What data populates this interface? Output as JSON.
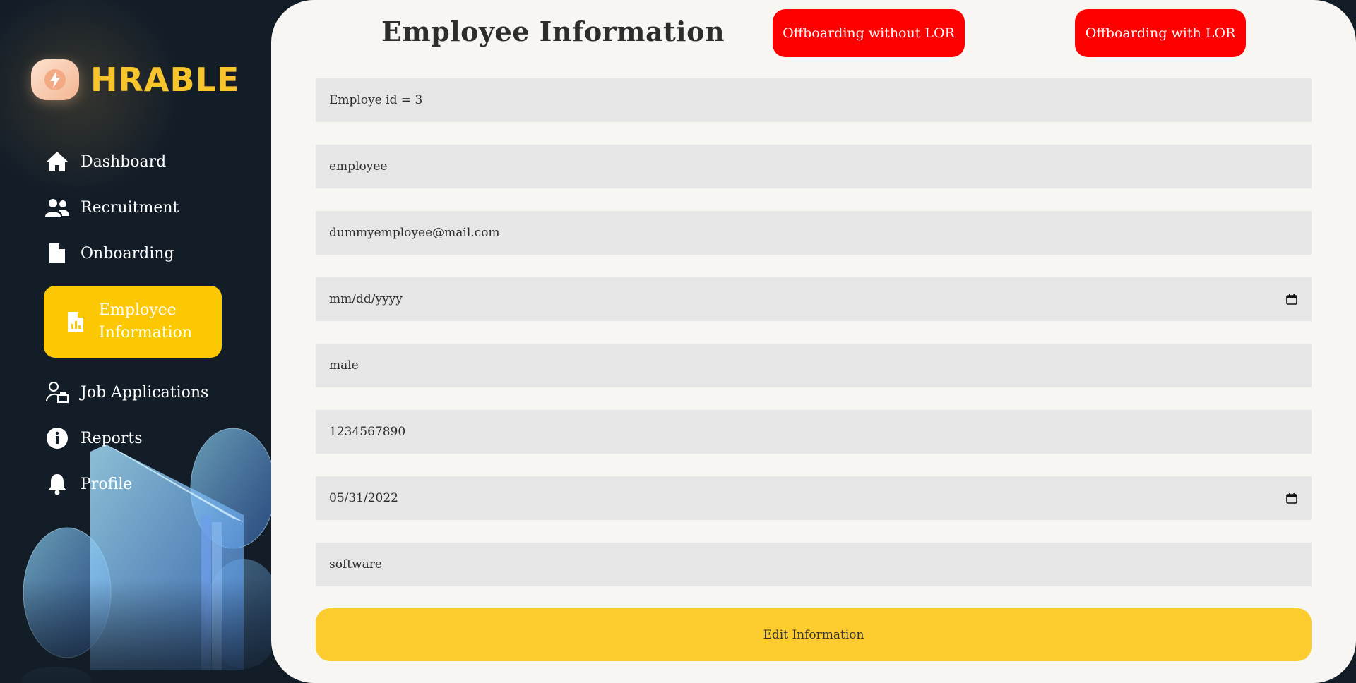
{
  "brand": {
    "name": "HRABLE",
    "logo_icon": "bolt-icon"
  },
  "sidebar": {
    "items": [
      {
        "label": "Dashboard",
        "icon": "home-icon"
      },
      {
        "label": "Recruitment",
        "icon": "users-icon"
      },
      {
        "label": "Onboarding",
        "icon": "file-icon"
      },
      {
        "label": "Employee Information",
        "icon": "file-chart-icon",
        "active": true
      },
      {
        "label": "Job Applications",
        "icon": "user-briefcase-icon"
      },
      {
        "label": "Reports",
        "icon": "info-icon"
      },
      {
        "label": "Profile",
        "icon": "bell-icon"
      }
    ]
  },
  "header": {
    "title": "Employee Information",
    "offboarding_without_lor": "Offboarding without LOR",
    "offboarding_with_lor": "Offboarding with LOR"
  },
  "form": {
    "employee_id": "Employe id = 3",
    "name": "employee",
    "email": "dummyemployee@mail.com",
    "dob_placeholder": "mm/dd/yyyy",
    "gender": "male",
    "phone": "1234567890",
    "join_date": "05/31/2022",
    "department": "software"
  },
  "actions": {
    "edit_label": "Edit Information"
  },
  "colors": {
    "sidebar_bg": "#131d28",
    "accent_yellow": "#fbc803",
    "danger_red": "#fe0000",
    "card_bg": "#f8f6f2",
    "field_bg": "#e6e6e6"
  }
}
